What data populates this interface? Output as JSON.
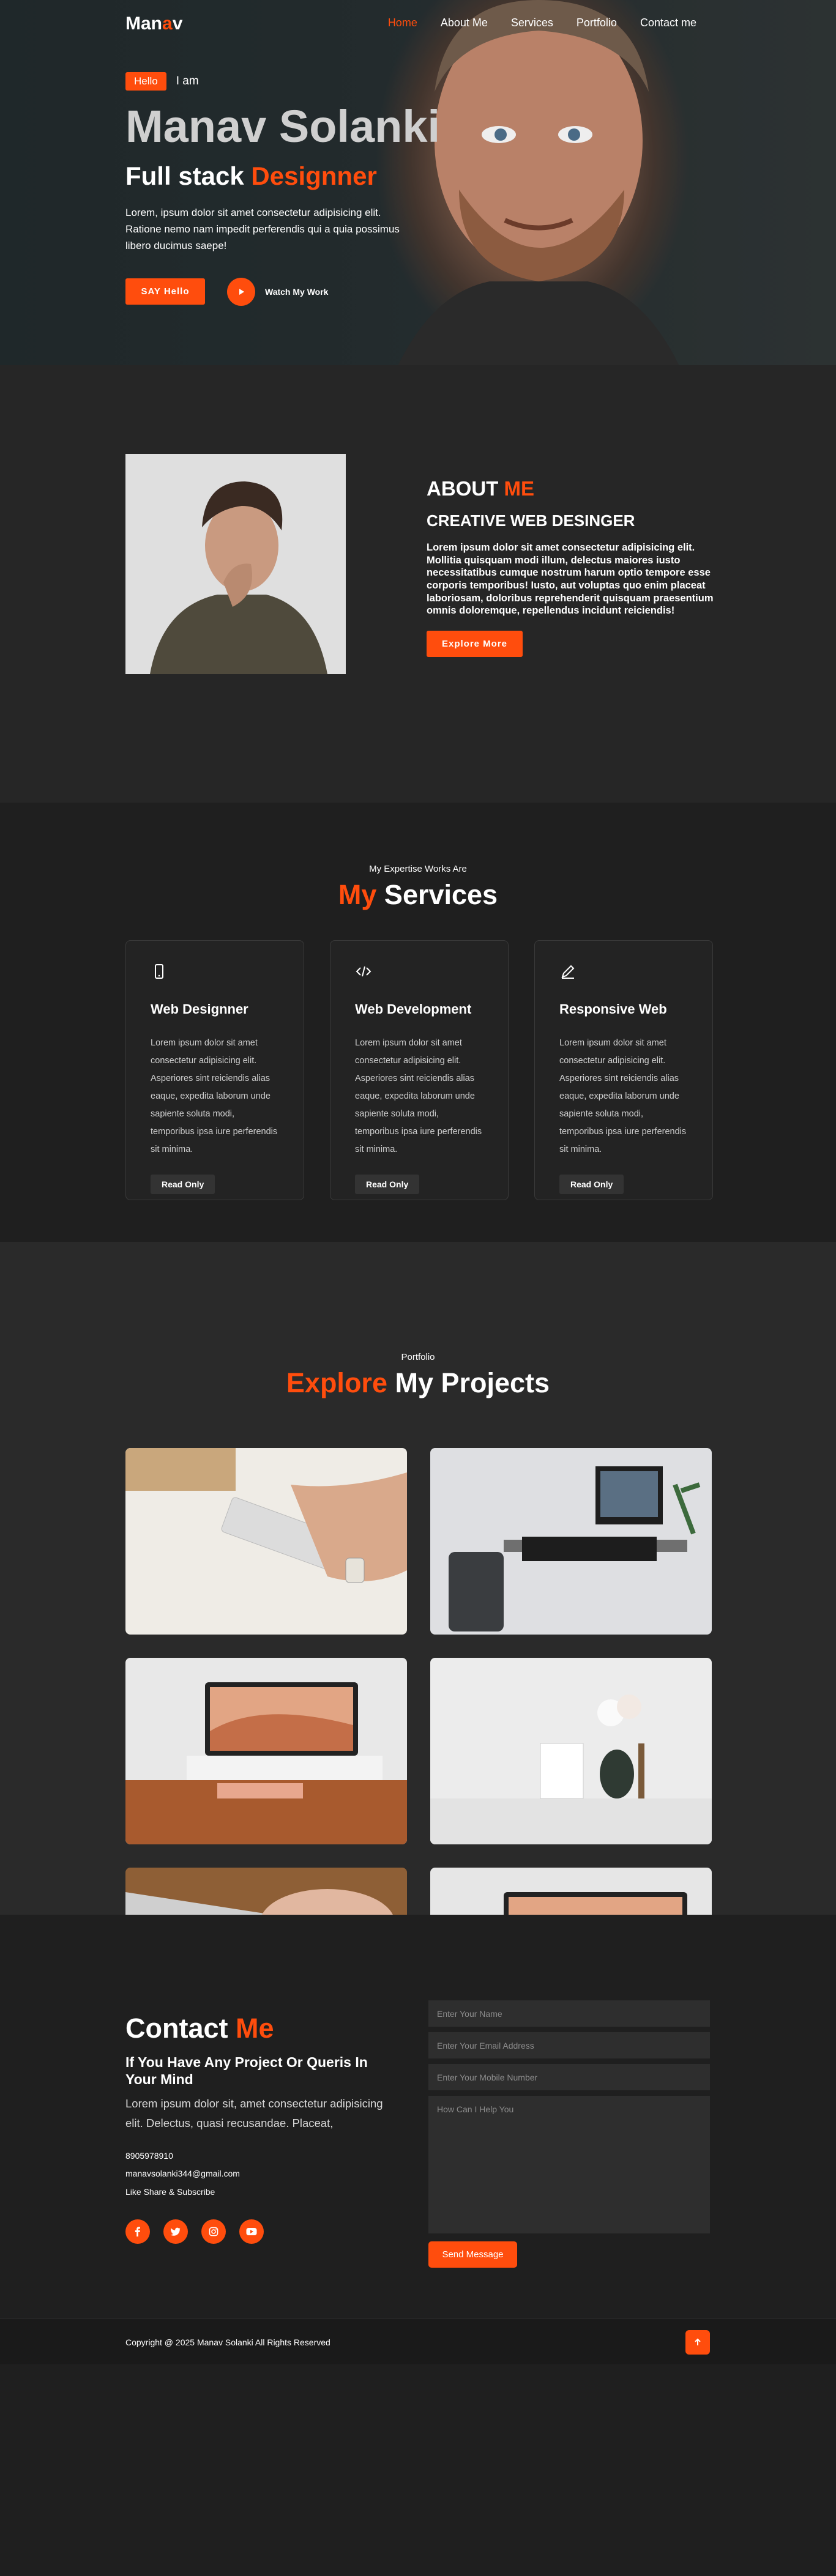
{
  "nav": {
    "logo_a": "Man",
    "logo_b": "a",
    "logo_c": "v",
    "links": [
      "Home",
      "About Me",
      "Services",
      "Portfolio",
      "Contact me"
    ]
  },
  "hero": {
    "hello": "Hello",
    "iam": "I am",
    "name": "Manav Solanki",
    "role_a": "Full stack ",
    "role_b": "Designner",
    "text": "Lorem, ipsum dolor sit amet consectetur adipisicing elit. Ratione nemo nam impedit perferendis qui a quia possimus libero ducimus saepe!",
    "cta": "SAY Hello",
    "watch": "Watch My Work"
  },
  "about": {
    "title_a": "ABOUT ",
    "title_b": "ME",
    "subtitle": "CREATIVE WEB DESINGER",
    "body": "Lorem ipsum dolor sit amet consectetur adipisicing elit. Mollitia quisquam modi illum, delectus maiores iusto necessitatibus cumque nostrum harum optio tempore esse corporis temporibus! Iusto, aut voluptas quo enim placeat laboriosam, doloribus reprehenderit quisquam praesentium omnis doloremque, repellendus incidunt reiciendis!",
    "button": "Explore More"
  },
  "services": {
    "eyebrow": "My Expertise Works Are",
    "title_a": "My",
    "title_b": " Services",
    "cards": [
      {
        "icon": "mobile-icon",
        "title": "Web Designner",
        "body": "Lorem ipsum dolor sit amet consectetur adipisicing elit. Asperiores sint reiciendis alias eaque, expedita laborum unde sapiente soluta modi, temporibus ipsa iure perferendis sit minima.",
        "button": "Read Only"
      },
      {
        "icon": "code-icon",
        "title": "Web Development",
        "body": "Lorem ipsum dolor sit amet consectetur adipisicing elit. Asperiores sint reiciendis alias eaque, expedita laborum unde sapiente soluta modi, temporibus ipsa iure perferendis sit minima.",
        "button": "Read Only"
      },
      {
        "icon": "pen-icon",
        "title": "Responsive Web",
        "body": "Lorem ipsum dolor sit amet consectetur adipisicing elit. Asperiores sint reiciendis alias eaque, expedita laborum unde sapiente soluta modi, temporibus ipsa iure perferendis sit minima.",
        "button": "Read Only"
      }
    ]
  },
  "portfolio": {
    "eyebrow": "Portfolio",
    "title_a": "Explore",
    "title_b": " My Projects"
  },
  "contact": {
    "title_a": "Contact ",
    "title_b": "Me",
    "subtitle": "If You Have Any Project Or Queris In Your Mind",
    "text": "Lorem ipsum dolor sit, amet consectetur adipisicing elit. Delectus, quasi recusandae. Placeat,",
    "phone": "8905978910",
    "email": "manavsolanki344@gmail.com",
    "share": "Like Share & Subscribe",
    "socials": [
      "facebook-icon",
      "twitter-icon",
      "instagram-icon",
      "youtube-icon"
    ],
    "form": {
      "name_placeholder": "Enter Your Name",
      "email_placeholder": "Enter Your Email Address",
      "mobile_placeholder": "Enter Your Mobile Number",
      "message_placeholder": "How Can I Help You",
      "send": "Send Message"
    }
  },
  "footer": {
    "copyright": "Copyright @ 2025 Manav Solanki All Rights Reserved"
  },
  "colors": {
    "accent": "#ff4d0d",
    "background": "#1f1f1f"
  }
}
